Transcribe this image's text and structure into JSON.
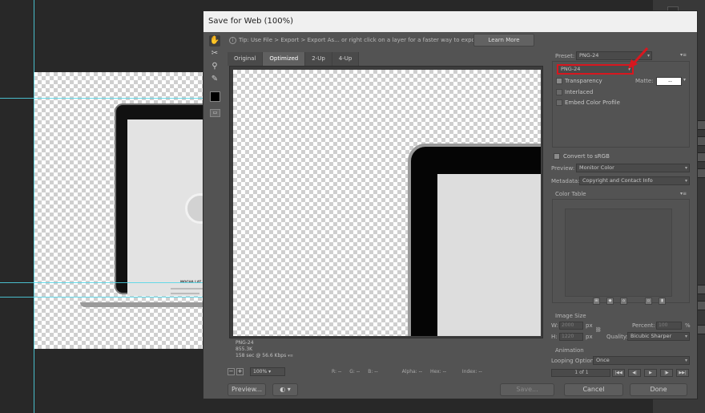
{
  "dialog": {
    "title": "Save for Web (100%)",
    "tip_text": "Tip: Use File > Export > Export As...  or right click on a layer for a faster way to export assets",
    "learn_more_label": "Learn More"
  },
  "tabs": [
    {
      "label": "Original",
      "active": false
    },
    {
      "label": "Optimized",
      "active": true
    },
    {
      "label": "2-Up",
      "active": false
    },
    {
      "label": "4-Up",
      "active": false
    }
  ],
  "tools": [
    "hand-icon",
    "slice-select-icon",
    "zoom-icon",
    "eyedropper-icon",
    "eyedropper-color-swatch",
    "toggle-slices-icon"
  ],
  "preview_info": {
    "format": "PNG-24",
    "size": "855.3K",
    "time": "158 sec @ 56.6 Kbps"
  },
  "statusbar": {
    "zoom": "100%",
    "r_label": "R:",
    "r_value": "--",
    "g_label": "G:",
    "g_value": "--",
    "b_label": "B:",
    "b_value": "--",
    "alpha_label": "Alpha:",
    "alpha_value": "--",
    "hex_label": "Hex:",
    "hex_value": "--",
    "index_label": "Index:",
    "index_value": "--"
  },
  "buttons": {
    "preview": "Preview...",
    "save": "Save...",
    "cancel": "Cancel",
    "done": "Done"
  },
  "settings": {
    "preset_label": "Preset:",
    "preset_value": "PNG-24",
    "format_value": "PNG-24",
    "transparency_label": "Transparency",
    "matte_label": "Matte:",
    "matte_value": "--",
    "interlaced_label": "Interlaced",
    "embed_profile_label": "Embed Color Profile",
    "convert_srgb_label": "Convert to sRGB",
    "preview_label": "Preview:",
    "preview_value": "Monitor Color",
    "metadata_label": "Metadata:",
    "metadata_value": "Copyright and Contact Info",
    "color_table_label": "Color Table",
    "image_size_label": "Image Size",
    "w_label": "W:",
    "w_value": "2000",
    "w_unit": "px",
    "h_label": "H:",
    "h_value": "1220",
    "h_unit": "px",
    "percent_label": "Percent:",
    "percent_value": "100",
    "percent_unit": "%",
    "quality_label": "Quality:",
    "quality_value": "Bicubic Sharper",
    "animation_label": "Animation",
    "looping_label": "Looping Options:",
    "looping_value": "Once",
    "frame_counter": "1 of 1"
  },
  "background": {
    "heading": "MOCHA LAT"
  },
  "colors": {
    "dialog_bg": "#535353",
    "highlight": "#d8171f",
    "guide": "#4fd6e8"
  }
}
